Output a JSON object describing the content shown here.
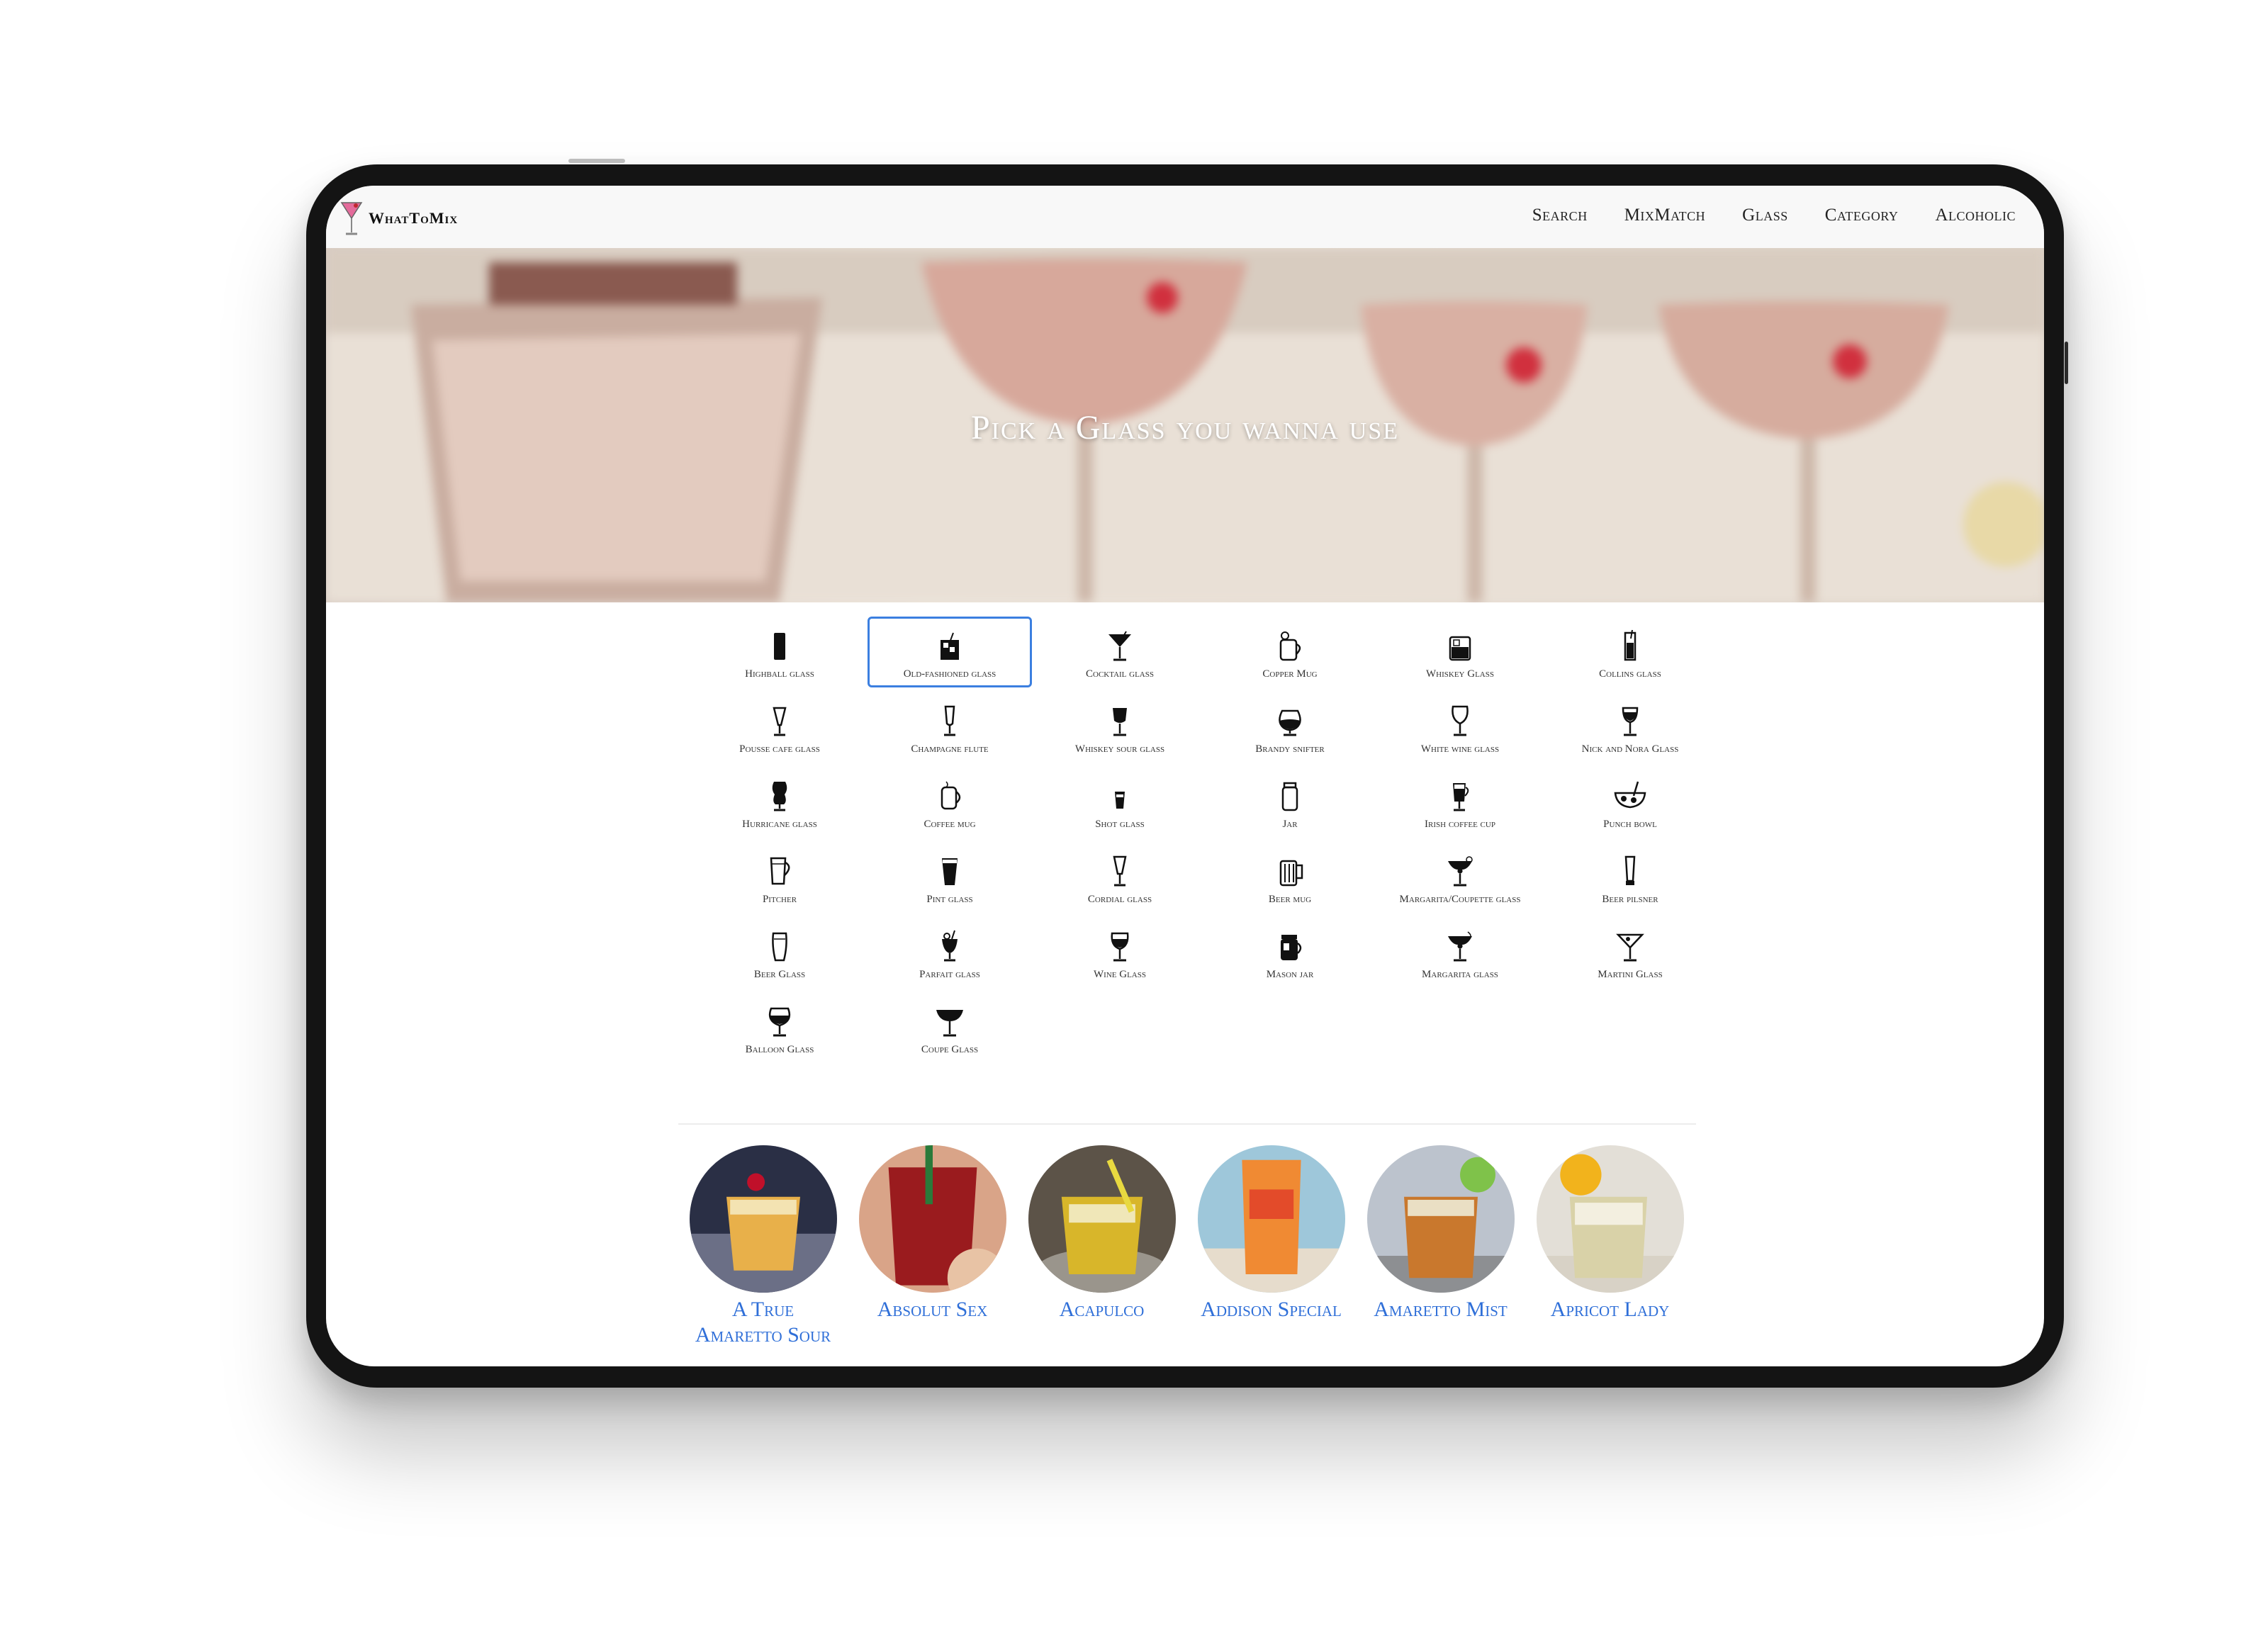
{
  "navbar": {
    "brand": "WhatToMix",
    "links": [
      "Search",
      "MixMatch",
      "Glass",
      "Category",
      "Alcoholic"
    ]
  },
  "hero": {
    "title": "Pick a Glass you wanna use"
  },
  "glasses": [
    {
      "label": "Highball glass",
      "icon": "highball-glass-icon"
    },
    {
      "label": "Old-fashioned glass",
      "icon": "old-fashioned-glass-icon",
      "selected": true
    },
    {
      "label": "Cocktail glass",
      "icon": "cocktail-glass-icon"
    },
    {
      "label": "Copper Mug",
      "icon": "copper-mug-icon"
    },
    {
      "label": "Whiskey Glass",
      "icon": "whiskey-glass-icon"
    },
    {
      "label": "Collins glass",
      "icon": "collins-glass-icon"
    },
    {
      "label": "Pousse cafe glass",
      "icon": "pousse-cafe-glass-icon"
    },
    {
      "label": "Champagne flute",
      "icon": "champagne-flute-icon"
    },
    {
      "label": "Whiskey sour glass",
      "icon": "whiskey-sour-glass-icon"
    },
    {
      "label": "Brandy snifter",
      "icon": "brandy-snifter-icon"
    },
    {
      "label": "White wine glass",
      "icon": "white-wine-glass-icon"
    },
    {
      "label": "Nick and Nora Glass",
      "icon": "nick-and-nora-glass-icon"
    },
    {
      "label": "Hurricane glass",
      "icon": "hurricane-glass-icon"
    },
    {
      "label": "Coffee mug",
      "icon": "coffee-mug-icon"
    },
    {
      "label": "Shot glass",
      "icon": "shot-glass-icon"
    },
    {
      "label": "Jar",
      "icon": "jar-icon"
    },
    {
      "label": "Irish coffee cup",
      "icon": "irish-coffee-cup-icon"
    },
    {
      "label": "Punch bowl",
      "icon": "punch-bowl-icon"
    },
    {
      "label": "Pitcher",
      "icon": "pitcher-icon"
    },
    {
      "label": "Pint glass",
      "icon": "pint-glass-icon"
    },
    {
      "label": "Cordial glass",
      "icon": "cordial-glass-icon"
    },
    {
      "label": "Beer mug",
      "icon": "beer-mug-icon"
    },
    {
      "label": "Margarita/Coupette glass",
      "icon": "margarita-coupette-glass-icon"
    },
    {
      "label": "Beer pilsner",
      "icon": "beer-pilsner-icon"
    },
    {
      "label": "Beer Glass",
      "icon": "beer-glass-icon"
    },
    {
      "label": "Parfait glass",
      "icon": "parfait-glass-icon"
    },
    {
      "label": "Wine Glass",
      "icon": "wine-glass-icon"
    },
    {
      "label": "Mason jar",
      "icon": "mason-jar-icon"
    },
    {
      "label": "Margarita glass",
      "icon": "margarita-glass-icon"
    },
    {
      "label": "Martini Glass",
      "icon": "martini-glass-icon"
    },
    {
      "label": "Balloon Glass",
      "icon": "balloon-glass-icon"
    },
    {
      "label": "Coupe Glass",
      "icon": "coupe-glass-icon"
    }
  ],
  "drinks": [
    {
      "name": "A True Amaretto Sour"
    },
    {
      "name": "Absolut Sex"
    },
    {
      "name": "Acapulco"
    },
    {
      "name": "Addison Special"
    },
    {
      "name": "Amaretto Mist"
    },
    {
      "name": "Apricot Lady"
    }
  ],
  "colors": {
    "accent": "#3b7fe0",
    "link": "#2f6fd8",
    "frame": "#141414",
    "navbar_bg": "#f8f8f8"
  }
}
